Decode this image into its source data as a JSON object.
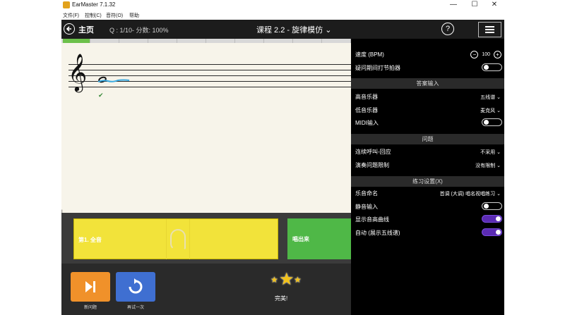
{
  "window": {
    "title": "EarMaster 7.1.32",
    "buttons": {
      "minimize": "—",
      "maximize": "☐",
      "close": "✕"
    }
  },
  "menubar": [
    "文件(F)",
    "控制(C)",
    "音符(O)",
    "帮助"
  ],
  "toolbar": {
    "home_label": "主页",
    "status": "Q : 1/10- 分数: 100%",
    "course": "课程 2.2 - 旋律模仿",
    "help_label": "?"
  },
  "progress": {
    "completed": 1,
    "total": 10
  },
  "staff": {
    "check": "✔",
    "left_marker": "I",
    "clef": "𝄞"
  },
  "settings": {
    "tempo_label": "速度 (BPM)",
    "tempo_value": "100",
    "metronome_label": "疑问期间打节拍器",
    "section_answer": "答案输入",
    "high_instrument_label": "高音乐器",
    "high_instrument_value": "五线谱",
    "low_instrument_label": "低音乐器",
    "low_instrument_value": "麦克风",
    "midi_label": "MIDI输入",
    "section_question": "问题",
    "call_response_label": "连续呼叫-回应",
    "call_response_value": "不采用",
    "limit_label": "演奏问题限制",
    "limit_value": "没有限制",
    "section_practice": "练习设置(X)",
    "solfege_label": "乐音命名",
    "solfege_value": "首调 (大调) 唱名视唱练习",
    "mute_label": "静音输入",
    "pitch_curve_label": "显示音高曲线",
    "auto_label": "自动 (展示五线谱)"
  },
  "toggles": {
    "metronome": false,
    "midi": false,
    "mute": false,
    "pitch_curve": true,
    "auto": true
  },
  "answer": {
    "tile1_label": "第1. 全音",
    "tile2_label": "唱出来"
  },
  "bottom": {
    "next_label": "新问题",
    "retry_label": "再试一次",
    "result_text": "完美!"
  },
  "colors": {
    "accent_purple": "#5b2bb3",
    "tile_yellow": "#f2e33a",
    "tile_green": "#4fb847",
    "next_orange": "#f0912a",
    "retry_blue": "#3f6fd1",
    "progress_green": "#6cc04a"
  }
}
